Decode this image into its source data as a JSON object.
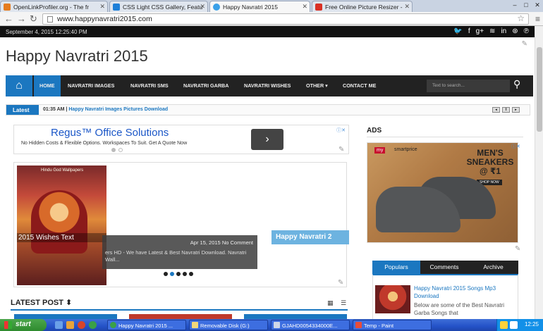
{
  "browser": {
    "tabs": [
      {
        "label": "OpenLinkProfiler.org - The fr",
        "icon": "bar-chart-icon",
        "color": "#e57c1f"
      },
      {
        "label": "CSS Light CSS Gallery, Featu",
        "icon": "css-gallery-icon",
        "color": "#1e7fd8"
      },
      {
        "label": "Happy Navratri 2015",
        "icon": "site-favicon-icon",
        "color": "#3aa0e8"
      },
      {
        "label": "Free Online Picture Resizer -",
        "icon": "resizer-icon",
        "color": "#d93025"
      }
    ],
    "url": "www.happynavratri2015.com"
  },
  "site": {
    "date": "September 4, 2015 12:25:40 PM",
    "title": "Happy Navratri 2015",
    "social_icons": [
      "twitter-icon",
      "facebook-icon",
      "google-plus-icon",
      "rss-icon",
      "linkedin-icon",
      "dribbble-icon",
      "pinterest-icon"
    ],
    "social_glyphs": [
      "🐦",
      "f",
      "g+",
      "≋",
      "in",
      "⊛",
      "℗"
    ],
    "nav": {
      "home_icon": "home-icon",
      "items": [
        "HOME",
        "NAVRATRI IMAGES",
        "NAVRATRI SMS",
        "NAVRATRI GARBA",
        "NAVRATRI WISHES",
        "OTHER ▾",
        "CONTACT ME"
      ],
      "search_placeholder": "Text to search...",
      "accent": "#1b77c0"
    },
    "ticker": {
      "label": "Latest",
      "time": "01:35 AM |",
      "link": "Happy Navratri Images Pictures Download"
    }
  },
  "ad": {
    "title": "Regus™ Office Solutions",
    "subtitle": "No Hidden Costs & Flexible Options. Workspaces To Suit. Get A Quote Now",
    "cta": "›"
  },
  "slider": {
    "image_brand": "Hindu God Wallpapers",
    "slide_title": "2015 Wishes Text",
    "caption_date": "Apr 15, 2015 No Comment",
    "caption_desc": "ers HD - We have Latest & Best Navratri Download. Navratri Wall...",
    "side_label": "Happy Navratri 2"
  },
  "latest_post": {
    "heading": "LATEST POST ⬍",
    "view_icons": "▦ ☰"
  },
  "sidebar": {
    "ads_label": "ADS",
    "ad_brand": "my",
    "ad_brand2": "smartprice",
    "ad_text": "MEN'S SNEAKERS @ ₹1",
    "ad_cta": "SHOP NOW",
    "tabs": [
      "Populars",
      "Comments",
      "Archive"
    ],
    "popular_title": "Happy Navratri 2015 Songs Mp3 Download",
    "popular_desc": "Below are some of the Best Navratri Garba Songs that"
  },
  "taskbar": {
    "start": "start",
    "tasks": [
      "Happy Navratri 2015 ...",
      "Removable Disk (G:)",
      "GJAHD0054334000E...",
      "Temp - Paint"
    ],
    "clock": "12:25"
  }
}
